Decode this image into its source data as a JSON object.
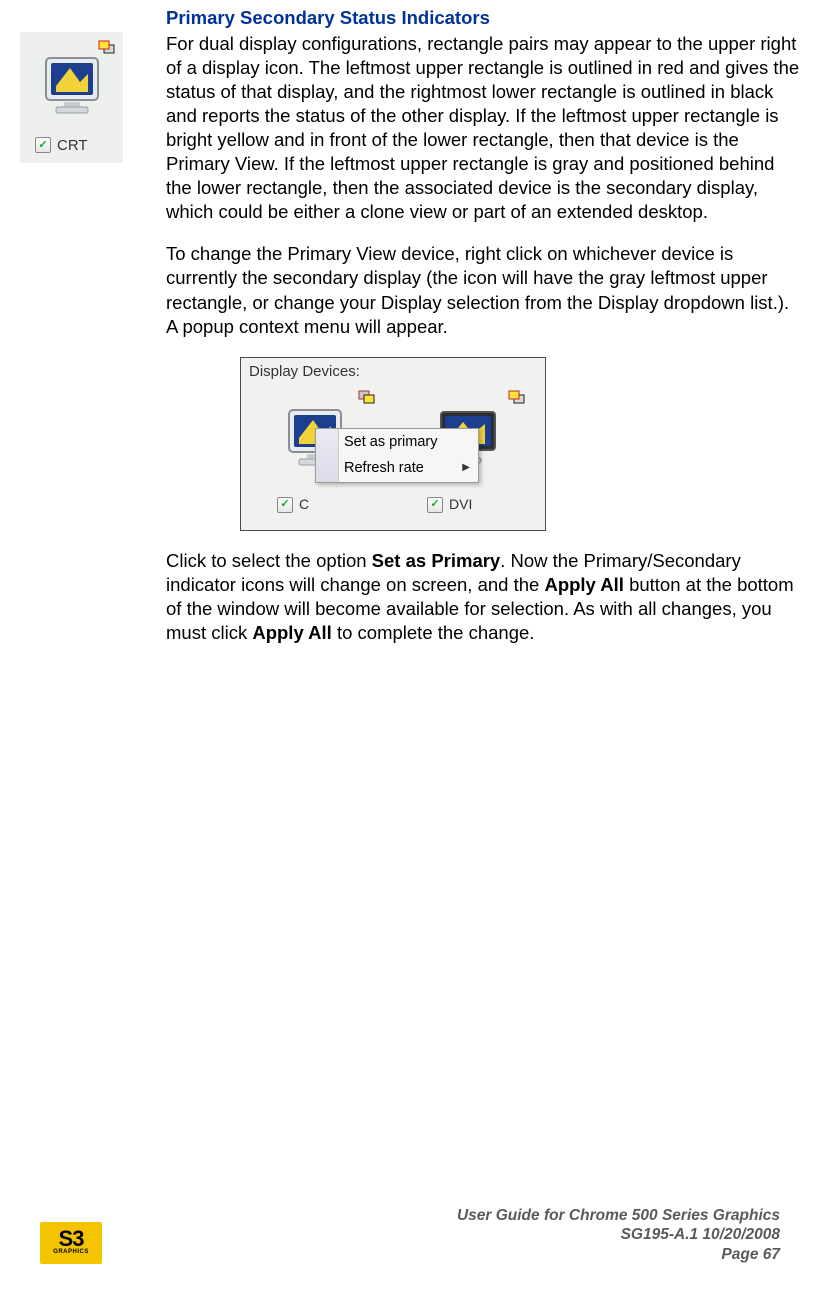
{
  "heading": "Primary Secondary Status Indicators",
  "para1": "For dual display configurations, rectangle pairs may appear to the upper right of a display icon. The leftmost upper rectangle is outlined in red and gives the status of that display, and the rightmost lower rectangle is outlined in black and reports the status of the other display. If the leftmost upper rectangle is bright yellow and in front of the lower rectangle, then that device is the Primary View. If the leftmost upper rectangle is gray and positioned behind the lower rectangle, then the associated device is the secondary display, which could be either a clone view or part of an extended desktop.",
  "para2": "To change the Primary View device, right click on whichever device is currently the secondary display (the icon will have the gray leftmost upper rectangle, or change your Display selection from the Display dropdown list.). A popup context menu will appear.",
  "para3_a": "Click to select the option ",
  "para3_b": "Set as Primary",
  "para3_c": ". Now the Primary/Secondary indicator icons will change on screen, and the ",
  "para3_d": "Apply All",
  "para3_e": " button at the bottom of the window will become available for selection. As with all changes, you must click ",
  "para3_f": "Apply All",
  "para3_g": " to complete the change.",
  "crt": {
    "label": "CRT",
    "checked": true
  },
  "dialog": {
    "title": "Display Devices:",
    "left_label": "C",
    "right_label": "DVI",
    "menu": {
      "item1": "Set as primary",
      "item2": "Refresh rate"
    }
  },
  "footer": {
    "logo_big": "S3",
    "logo_small": "GRAPHICS",
    "line1": "User Guide for Chrome 500 Series Graphics",
    "line2": "SG195-A.1   10/20/2008",
    "line3a": "Page ",
    "line3b": "67"
  }
}
